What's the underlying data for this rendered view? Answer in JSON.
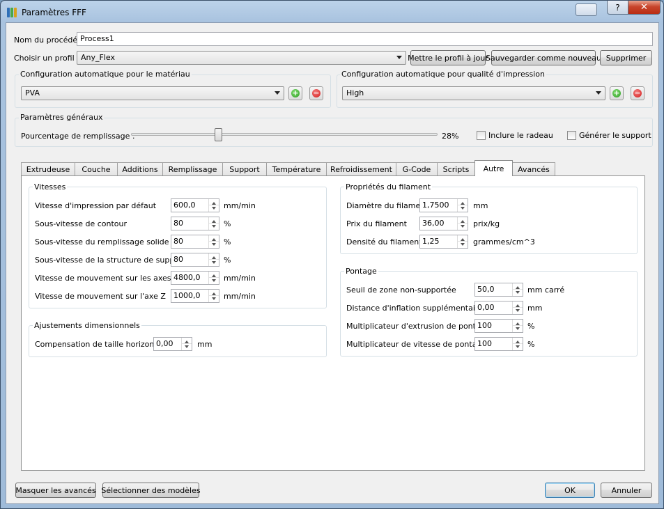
{
  "window": {
    "title": "Paramètres FFF",
    "help_label": "?",
    "close_label": "✕"
  },
  "process": {
    "name_label": "Nom du procédé :",
    "name_value": "Process1"
  },
  "profile": {
    "label": "Choisir un profil :",
    "value": "Any_Flex",
    "update_button": "Mettre le profil à jour",
    "save_new_button": "Sauvegarder comme nouveau",
    "delete_button": "Supprimer"
  },
  "material": {
    "title": "Configuration automatique pour le matériau",
    "value": "PVA"
  },
  "quality": {
    "title": "Configuration automatique pour qualité d'impression",
    "value": "High"
  },
  "general": {
    "title": "Paramètres généraux",
    "infill_label": "Pourcentage de remplissage :",
    "infill_value_text": "28%",
    "infill_fraction": 0.28,
    "raft_label": "Inclure le radeau",
    "support_label": "Générer le support"
  },
  "tabs": [
    "Extrudeuse",
    "Couche",
    "Additions",
    "Remplissage",
    "Support",
    "Température",
    "Refroidissement",
    "G-Code",
    "Scripts",
    "Autre",
    "Avancés"
  ],
  "active_tab": "Autre",
  "speeds": {
    "title": "Vitesses",
    "rows": [
      {
        "label": "Vitesse d'impression par défaut",
        "value": "600,0",
        "unit": "mm/min"
      },
      {
        "label": "Sous-vitesse de contour",
        "value": "80",
        "unit": "%"
      },
      {
        "label": "Sous-vitesse du remplissage solide",
        "value": "80",
        "unit": "%"
      },
      {
        "label": "Sous-vitesse de la structure de support",
        "value": "80",
        "unit": "%"
      },
      {
        "label": "Vitesse de mouvement sur les axes X/Y",
        "value": "4800,0",
        "unit": "mm/min"
      },
      {
        "label": "Vitesse de mouvement sur l'axe Z",
        "value": "1000,0",
        "unit": "mm/min"
      }
    ]
  },
  "dimensional": {
    "title": "Ajustements dimensionnels",
    "label": "Compensation de taille horizontale",
    "value": "0,00",
    "unit": "mm"
  },
  "filament": {
    "title": "Propriétés du filament",
    "rows": [
      {
        "label": "Diamètre du filament",
        "value": "1,7500",
        "unit": "mm"
      },
      {
        "label": "Prix du filament",
        "value": "36,00",
        "unit": "prix/kg"
      },
      {
        "label": "Densité du filament",
        "value": "1,25",
        "unit": "grammes/cm^3"
      }
    ]
  },
  "bridging": {
    "title": "Pontage",
    "rows": [
      {
        "label": "Seuil de zone non-supportée",
        "value": "50,0",
        "unit": "mm carré"
      },
      {
        "label": "Distance d'inflation supplémentaire",
        "value": "0,00",
        "unit": "mm"
      },
      {
        "label": "Multiplicateur d'extrusion de pontage",
        "value": "100",
        "unit": "%"
      },
      {
        "label": "Multiplicateur de vitesse de pontage",
        "value": "100",
        "unit": "%"
      }
    ]
  },
  "footer": {
    "hide_advanced": "Masquer les avancés",
    "select_models": "Sélectionner des modèles",
    "ok": "OK",
    "cancel": "Annuler"
  }
}
